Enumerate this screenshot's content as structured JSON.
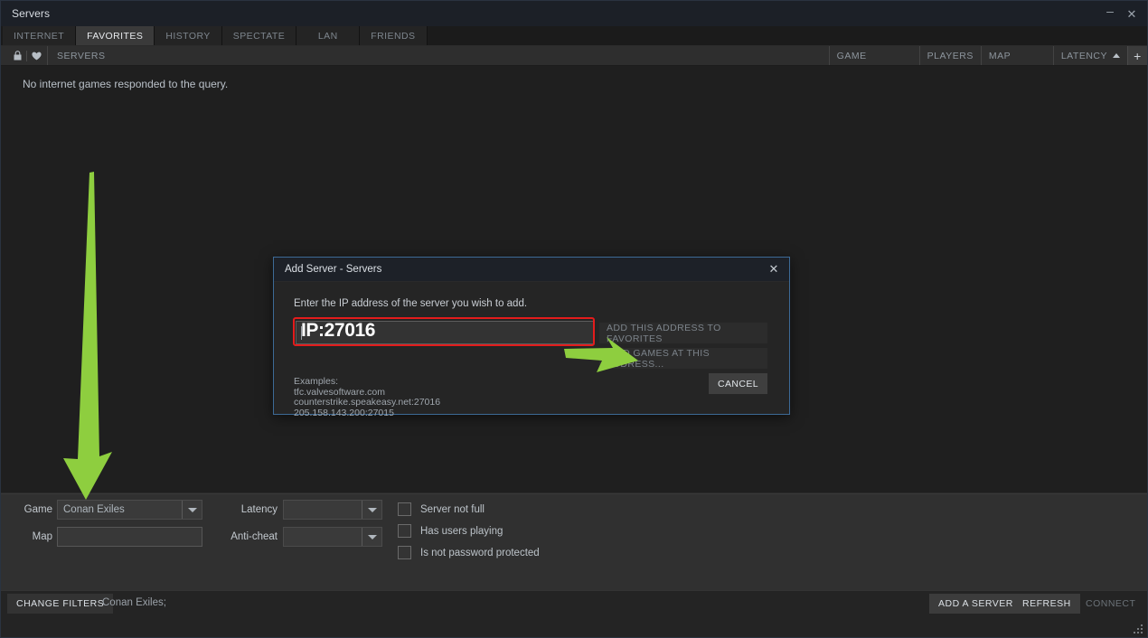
{
  "window": {
    "title": "Servers",
    "controls": [
      {
        "name": "minimize-button",
        "glyph": "–"
      },
      {
        "name": "close-button",
        "glyph": "✕"
      }
    ]
  },
  "tabs": [
    {
      "label": "INTERNET",
      "active": false
    },
    {
      "label": "FAVORITES",
      "active": true
    },
    {
      "label": "HISTORY",
      "active": false
    },
    {
      "label": "SPECTATE",
      "active": false
    },
    {
      "label": "LAN",
      "active": false
    },
    {
      "label": "FRIENDS",
      "active": false
    }
  ],
  "columns": {
    "lock_icon": "🔒",
    "favorite_icon": "♥",
    "servers": "SERVERS",
    "game": "GAME",
    "players": "PLAYERS",
    "map": "MAP",
    "latency": "LATENCY",
    "sort_direction": "ascending",
    "add_column": "+"
  },
  "list": {
    "empty_message": "No internet games responded to the query."
  },
  "filters": {
    "game_label": "Game",
    "game_value": "Conan Exiles",
    "map_label": "Map",
    "map_value": "",
    "map_placeholder": "",
    "latency_label": "Latency",
    "latency_value": "",
    "anticheat_label": "Anti-cheat",
    "anticheat_value": "",
    "checkboxes": [
      {
        "label": "Server not full",
        "checked": false
      },
      {
        "label": "Has users playing",
        "checked": false
      },
      {
        "label": "Is not password protected",
        "checked": false
      }
    ]
  },
  "bottom_bar": {
    "change_filters": "CHANGE FILTERS",
    "filter_summary": "Conan Exiles;",
    "add_a_server": "ADD A SERVER",
    "refresh": "REFRESH",
    "connect": "CONNECT"
  },
  "dialog": {
    "title": "Add Server - Servers",
    "close_glyph": "✕",
    "prompt": "Enter the IP address of the server you wish to add.",
    "ip_value": "",
    "ip_annotation": "IP:27016",
    "examples_heading": "Examples:",
    "examples": [
      "tfc.valvesoftware.com",
      "counterstrike.speakeasy.net:27016",
      "205.158.143.200:27015"
    ],
    "add_to_favorites": "ADD THIS ADDRESS TO FAVORITES",
    "find_games": "FIND GAMES AT THIS ADDRESS...",
    "cancel": "CANCEL"
  },
  "annotations": {
    "highlight_color": "#e31c1c",
    "arrow_color": "#8ece3f",
    "arrows": [
      {
        "name": "arrow-to-game-filter",
        "direction": "down"
      },
      {
        "name": "arrow-to-find-games-button",
        "direction": "right"
      }
    ]
  }
}
